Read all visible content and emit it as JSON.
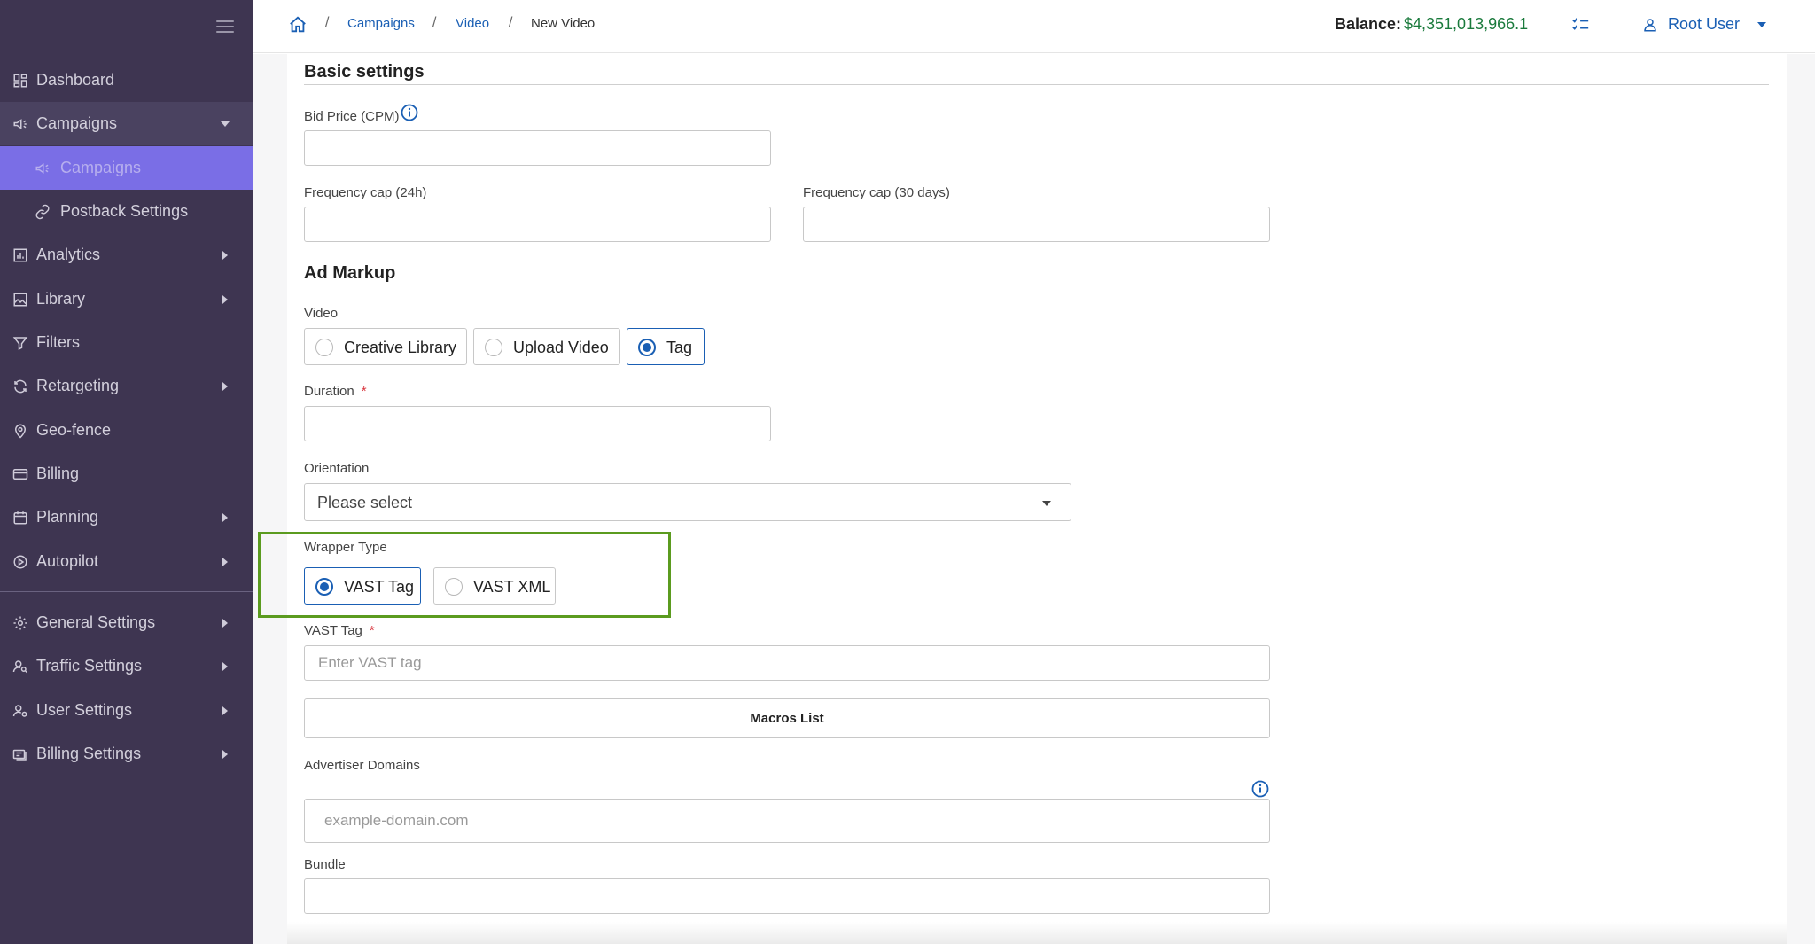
{
  "sidebar": {
    "items": [
      {
        "label": "Dashboard",
        "icon": "dashboard-icon"
      },
      {
        "label": "Campaigns",
        "icon": "megaphone-icon"
      },
      {
        "label": "Campaigns",
        "icon": "megaphone-icon"
      },
      {
        "label": "Postback Settings",
        "icon": "link-icon"
      },
      {
        "label": "Analytics",
        "icon": "bar-chart-icon"
      },
      {
        "label": "Library",
        "icon": "image-icon"
      },
      {
        "label": "Filters",
        "icon": "filter-icon"
      },
      {
        "label": "Retargeting",
        "icon": "refresh-icon"
      },
      {
        "label": "Geo-fence",
        "icon": "map-pin-icon"
      },
      {
        "label": "Billing",
        "icon": "credit-card-icon"
      },
      {
        "label": "Planning",
        "icon": "calendar-icon"
      },
      {
        "label": "Autopilot",
        "icon": "play-circle-icon"
      },
      {
        "label": "General Settings",
        "icon": "gear-icon"
      },
      {
        "label": "Traffic Settings",
        "icon": "user-search-icon"
      },
      {
        "label": "User Settings",
        "icon": "users-cog-icon"
      },
      {
        "label": "Billing Settings",
        "icon": "billing-icon"
      }
    ]
  },
  "header": {
    "breadcrumbs": [
      "Campaigns",
      "Video",
      "New Video"
    ],
    "balance_label": "Balance:",
    "balance_value": "$4,351,013,966.1",
    "user_name": "Root User"
  },
  "form": {
    "basic_settings_title": "Basic settings",
    "bid_price_label": "Bid Price (CPM)",
    "freq_cap_24h_label": "Frequency cap (24h)",
    "freq_cap_30d_label": "Frequency cap (30 days)",
    "ad_markup_title": "Ad Markup",
    "video_label": "Video",
    "video_options": [
      "Creative Library",
      "Upload Video",
      "Tag"
    ],
    "video_selected": "Tag",
    "duration_label": "Duration",
    "required_mark": "*",
    "orientation_label": "Orientation",
    "orientation_value": "Please select",
    "wrapper_type_label": "Wrapper Type",
    "wrapper_options": [
      "VAST Tag",
      "VAST XML"
    ],
    "wrapper_selected": "VAST Tag",
    "vast_tag_label": "VAST Tag",
    "vast_tag_placeholder": "Enter VAST tag",
    "macros_button": "Macros List",
    "advertiser_domains_label": "Advertiser Domains",
    "advertiser_domains_placeholder": "example-domain.com",
    "bundle_label": "Bundle"
  },
  "colors": {
    "sidebar_bg": "#3e3551",
    "sidebar_active": "#7a6ee6",
    "link_blue": "#1a5fb4",
    "balance_green": "#1a7a3c",
    "highlight_green": "#5b9b1f"
  }
}
